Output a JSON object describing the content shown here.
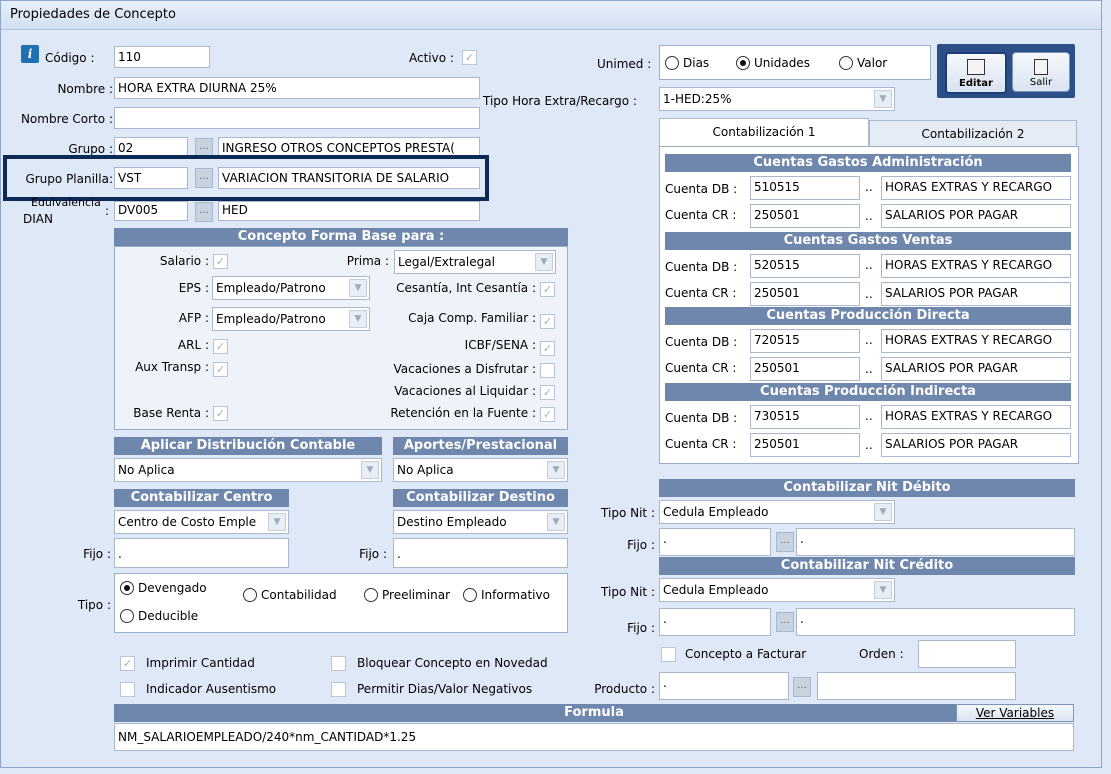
{
  "window": {
    "title": "Propiedades de Concepto"
  },
  "header": {
    "codigo_label": "Código :",
    "codigo": "110",
    "activo_label": "Activo :",
    "nombre_label": "Nombre :",
    "nombre": "HORA EXTRA DIURNA 25%",
    "nombre_corto_label": "Nombre Corto :",
    "nombre_corto": "",
    "grupo_label": "Grupo :",
    "grupo_code": "02",
    "grupo_name": "INGRESO OTROS CONCEPTOS PRESTA(",
    "grupo_planilla_label": "Grupo Planilla:",
    "grupo_planilla_code": "VST",
    "grupo_planilla_name": "VARIACION TRANSITORIA DE SALARIO",
    "equivalencia_label_1": "Equivalencia",
    "equivalencia_label_2": "DIAN",
    "equivalencia_code": "DV005",
    "equivalencia_name": "HED"
  },
  "unimed": {
    "label": "Unimed :",
    "options": [
      "Dias",
      "Unidades",
      "Valor"
    ],
    "selected": "Unidades"
  },
  "tipo_hora": {
    "label": "Tipo Hora Extra/Recargo :",
    "value": "1-HED:25%"
  },
  "toolbar": {
    "editar": "Editar",
    "salir": "Salir"
  },
  "base": {
    "title": "Concepto Forma Base para :",
    "salario": "Salario :",
    "prima": "Prima :",
    "prima_value": "Legal/Extralegal",
    "eps": "EPS :",
    "eps_value": "Empleado/Patrono",
    "cesantia": "Cesantía, Int Cesantía :",
    "afp": "AFP :",
    "afp_value": "Empleado/Patrono",
    "caja": "Caja Comp. Familiar :",
    "arl": "ARL :",
    "icbf": "ICBF/SENA :",
    "aux": "Aux Transp :",
    "vac_disfrutar": "Vacaciones a Disfrutar :",
    "vac_liquidar": "Vacaciones al Liquidar :",
    "base_renta": "Base Renta :",
    "retencion": "Retención en la Fuente :"
  },
  "distribucion": {
    "title": "Aplicar Distribución Contable",
    "value": "No Aplica"
  },
  "aportes": {
    "title": "Aportes/Prestacional",
    "value": "No Aplica"
  },
  "centro": {
    "title": "Contabilizar Centro",
    "value": "Centro de Costo Emple",
    "fijo_label": "Fijo :",
    "fijo": "."
  },
  "destino": {
    "title": "Contabilizar Destino",
    "value": "Destino Empleado",
    "fijo_label": "Fijo :",
    "fijo": "."
  },
  "tipo": {
    "label": "Tipo :",
    "options": [
      "Devengado",
      "Contabilidad",
      "Preeliminar",
      "Informativo",
      "Deducible"
    ],
    "selected": "Devengado"
  },
  "checks": {
    "imprimir": "Imprimir Cantidad",
    "bloquear": "Bloquear Concepto en Novedad",
    "indicador": "Indicador Ausentismo",
    "permitir": "Permitir Dias/Valor Negativos"
  },
  "formula": {
    "title": "Formula",
    "ver": "Ver Variables",
    "value": "NM_SALARIOEMPLEADO/240*nm_CANTIDAD*1.25"
  },
  "tabs": [
    "Contabilización 1",
    "Contabilización 2"
  ],
  "cuentas": [
    {
      "title": "Cuentas Gastos Administración",
      "db_label": "Cuenta DB :",
      "db": "510515",
      "db_name": "HORAS EXTRAS Y RECARGO",
      "cr_label": "Cuenta CR :",
      "cr": "250501",
      "cr_name": "SALARIOS POR PAGAR"
    },
    {
      "title": "Cuentas Gastos Ventas",
      "db_label": "Cuenta DB :",
      "db": "520515",
      "db_name": "HORAS EXTRAS Y RECARGO",
      "cr_label": "Cuenta CR :",
      "cr": "250501",
      "cr_name": "SALARIOS POR PAGAR"
    },
    {
      "title": "Cuentas Producción Directa",
      "db_label": "Cuenta DB :",
      "db": "720515",
      "db_name": "HORAS EXTRAS Y RECARGO",
      "cr_label": "Cuenta CR :",
      "cr": "250501",
      "cr_name": "SALARIOS POR PAGAR"
    },
    {
      "title": "Cuentas Producción Indirecta",
      "db_label": "Cuenta DB :",
      "db": "730515",
      "db_name": "HORAS EXTRAS Y RECARGO",
      "cr_label": "Cuenta CR :",
      "cr": "250501",
      "cr_name": "SALARIOS POR PAGAR"
    }
  ],
  "nit_debito": {
    "title": "Contabilizar Nit Débito",
    "tipo_label": "Tipo Nit :",
    "tipo": "Cedula Empleado",
    "fijo_label": "Fijo :",
    "fijo1": ".",
    "fijo2": "."
  },
  "nit_credito": {
    "title": "Contabilizar Nit Crédito",
    "tipo_label": "Tipo Nit :",
    "tipo": "Cedula Empleado",
    "fijo_label": "Fijo :",
    "fijo1": ".",
    "fijo2": "."
  },
  "facturar": {
    "label": "Concepto a Facturar",
    "orden_label": "Orden :",
    "orden": "",
    "producto_label": "Producto :",
    "producto": ".",
    "producto_name": ""
  }
}
